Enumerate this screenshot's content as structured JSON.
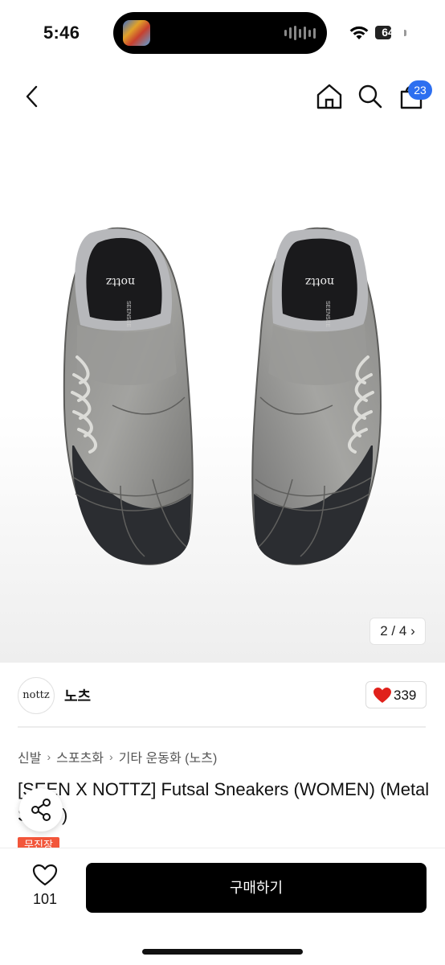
{
  "status_bar": {
    "time": "5:46",
    "battery": "64",
    "battery_level": 0.64,
    "icons": [
      "now-playing-thumbnail",
      "audio-waveform-icon",
      "wifi-icon",
      "battery-icon"
    ]
  },
  "nav": {
    "icons": [
      "back-arrow-icon",
      "home-icon",
      "search-icon",
      "shopping-bag-icon"
    ],
    "cart_count": "23"
  },
  "gallery": {
    "pager": "2 / 4",
    "insole_text_a": "nottz",
    "insole_text_b": "SEENSEE"
  },
  "seller": {
    "logo_text": "nottz",
    "name": "노츠",
    "like_count": "339"
  },
  "breadcrumbs": [
    "신발",
    "스포츠화",
    "기타 운동화 (노츠)"
  ],
  "product": {
    "title": "[SEEN X NOTTZ] Futsal Sneakers (WOMEN) (Metal Silver)",
    "badge": "무진장"
  },
  "bottom_bar": {
    "wish_count": "101",
    "buy_label": "구매하기"
  },
  "colors": {
    "accent_blue": "#2d6ff0",
    "like_red": "#e0211b",
    "badge_orange": "#f2563a",
    "buy_button": "#000000"
  }
}
